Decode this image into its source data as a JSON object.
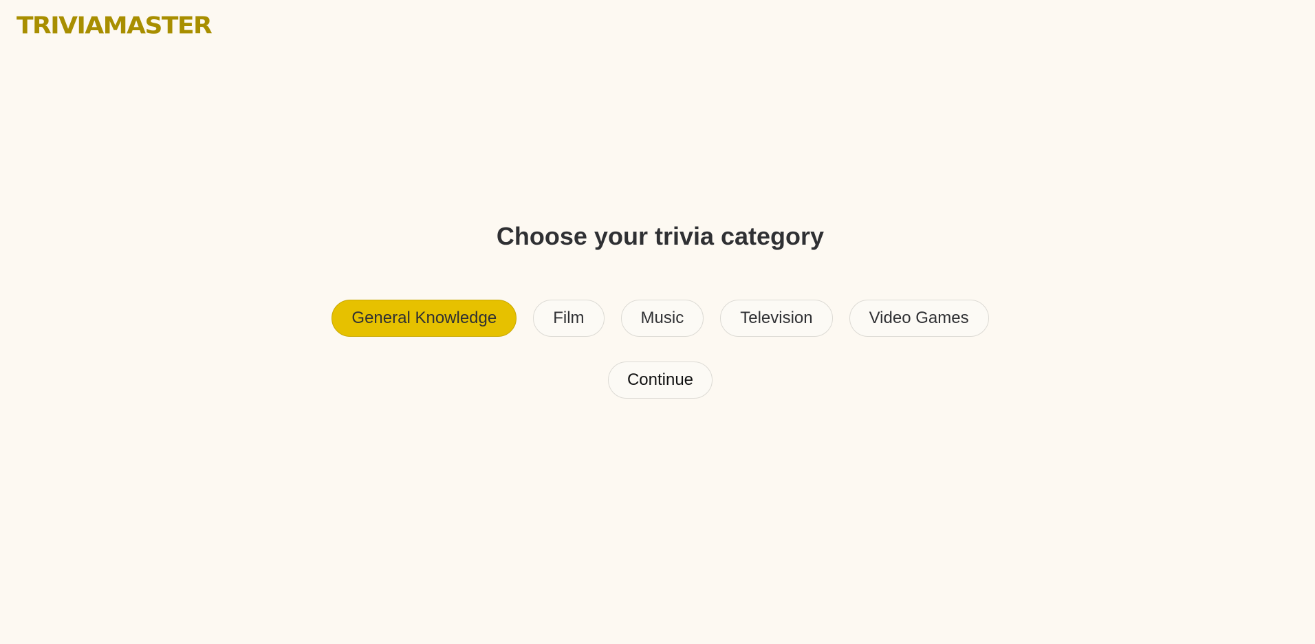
{
  "header": {
    "logo_text": "TRIVIAMASTER"
  },
  "main": {
    "heading": "Choose your trivia category",
    "categories": [
      {
        "label": "General Knowledge",
        "selected": true
      },
      {
        "label": "Film",
        "selected": false
      },
      {
        "label": "Music",
        "selected": false
      },
      {
        "label": "Television",
        "selected": false
      },
      {
        "label": "Video Games",
        "selected": false
      }
    ],
    "continue_label": "Continue"
  },
  "colors": {
    "background": "#fdf9f2",
    "brand": "#a88e00",
    "selected_chip": "#e6c100",
    "text": "#2f3033"
  }
}
